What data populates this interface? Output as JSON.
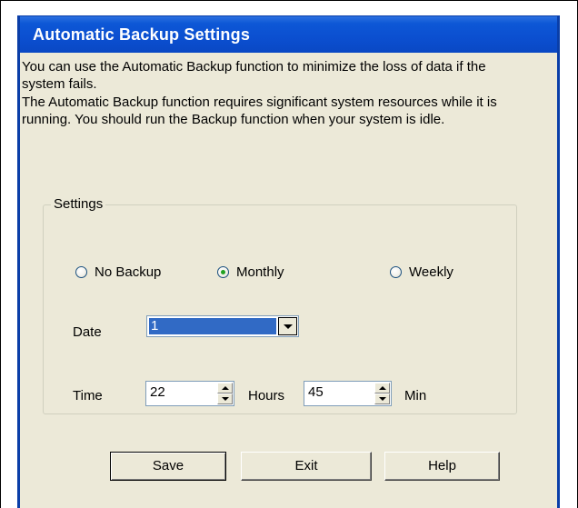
{
  "window": {
    "title": "Automatic Backup Settings"
  },
  "description": {
    "line1": "You can use the Automatic Backup function to minimize the loss of data if the system fails.",
    "line2": "The Automatic Backup function requires significant system resources while it is running. You should run the Backup function when your system is idle."
  },
  "settings": {
    "group_label": "Settings",
    "frequency_options": [
      {
        "label": "No Backup",
        "selected": false
      },
      {
        "label": "Monthly",
        "selected": true
      },
      {
        "label": "Weekly",
        "selected": false
      }
    ],
    "date_label": "Date",
    "date_value": "1",
    "time_label": "Time",
    "hours_value": "22",
    "hours_label": "Hours",
    "minutes_value": "45",
    "minutes_label": "Min"
  },
  "buttons": {
    "save": "Save",
    "exit": "Exit",
    "help": "Help"
  },
  "colors": {
    "titlebar": "#0b4fd0",
    "dialog_bg": "#ece9d8",
    "selection": "#316ac5",
    "radio_dot": "#21a121"
  },
  "icons": {
    "dropdown": "chevron-down-icon",
    "spin_up": "spin-up-icon",
    "spin_down": "spin-down-icon"
  }
}
